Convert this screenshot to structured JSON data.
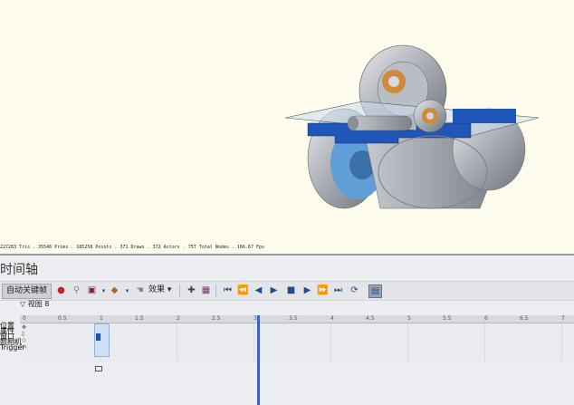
{
  "viewport": {
    "stats": "227283 Tris . 35546 Prims . 185258 Points . 371 Draws . 372 Actors . 757 Total Nodes . 166.67 Fps"
  },
  "timeline": {
    "title": "时间轴",
    "auto_key_label": "自动关键帧",
    "effects_label": "效果",
    "view_label": "视图 8",
    "ruler_ticks": [
      "0",
      "0.5",
      "1",
      "1.5",
      "2",
      "2.5",
      "3",
      "3.5",
      "4",
      "4.5",
      "5",
      "5.5",
      "6",
      "6.5",
      "7"
    ],
    "tracks": [
      "位置",
      "属性",
      "窗口",
      "照相机"
    ],
    "trigger_label": "Trigger"
  },
  "colors": {
    "accent": "#3d62c4",
    "keyframe": "#1a55aa"
  }
}
